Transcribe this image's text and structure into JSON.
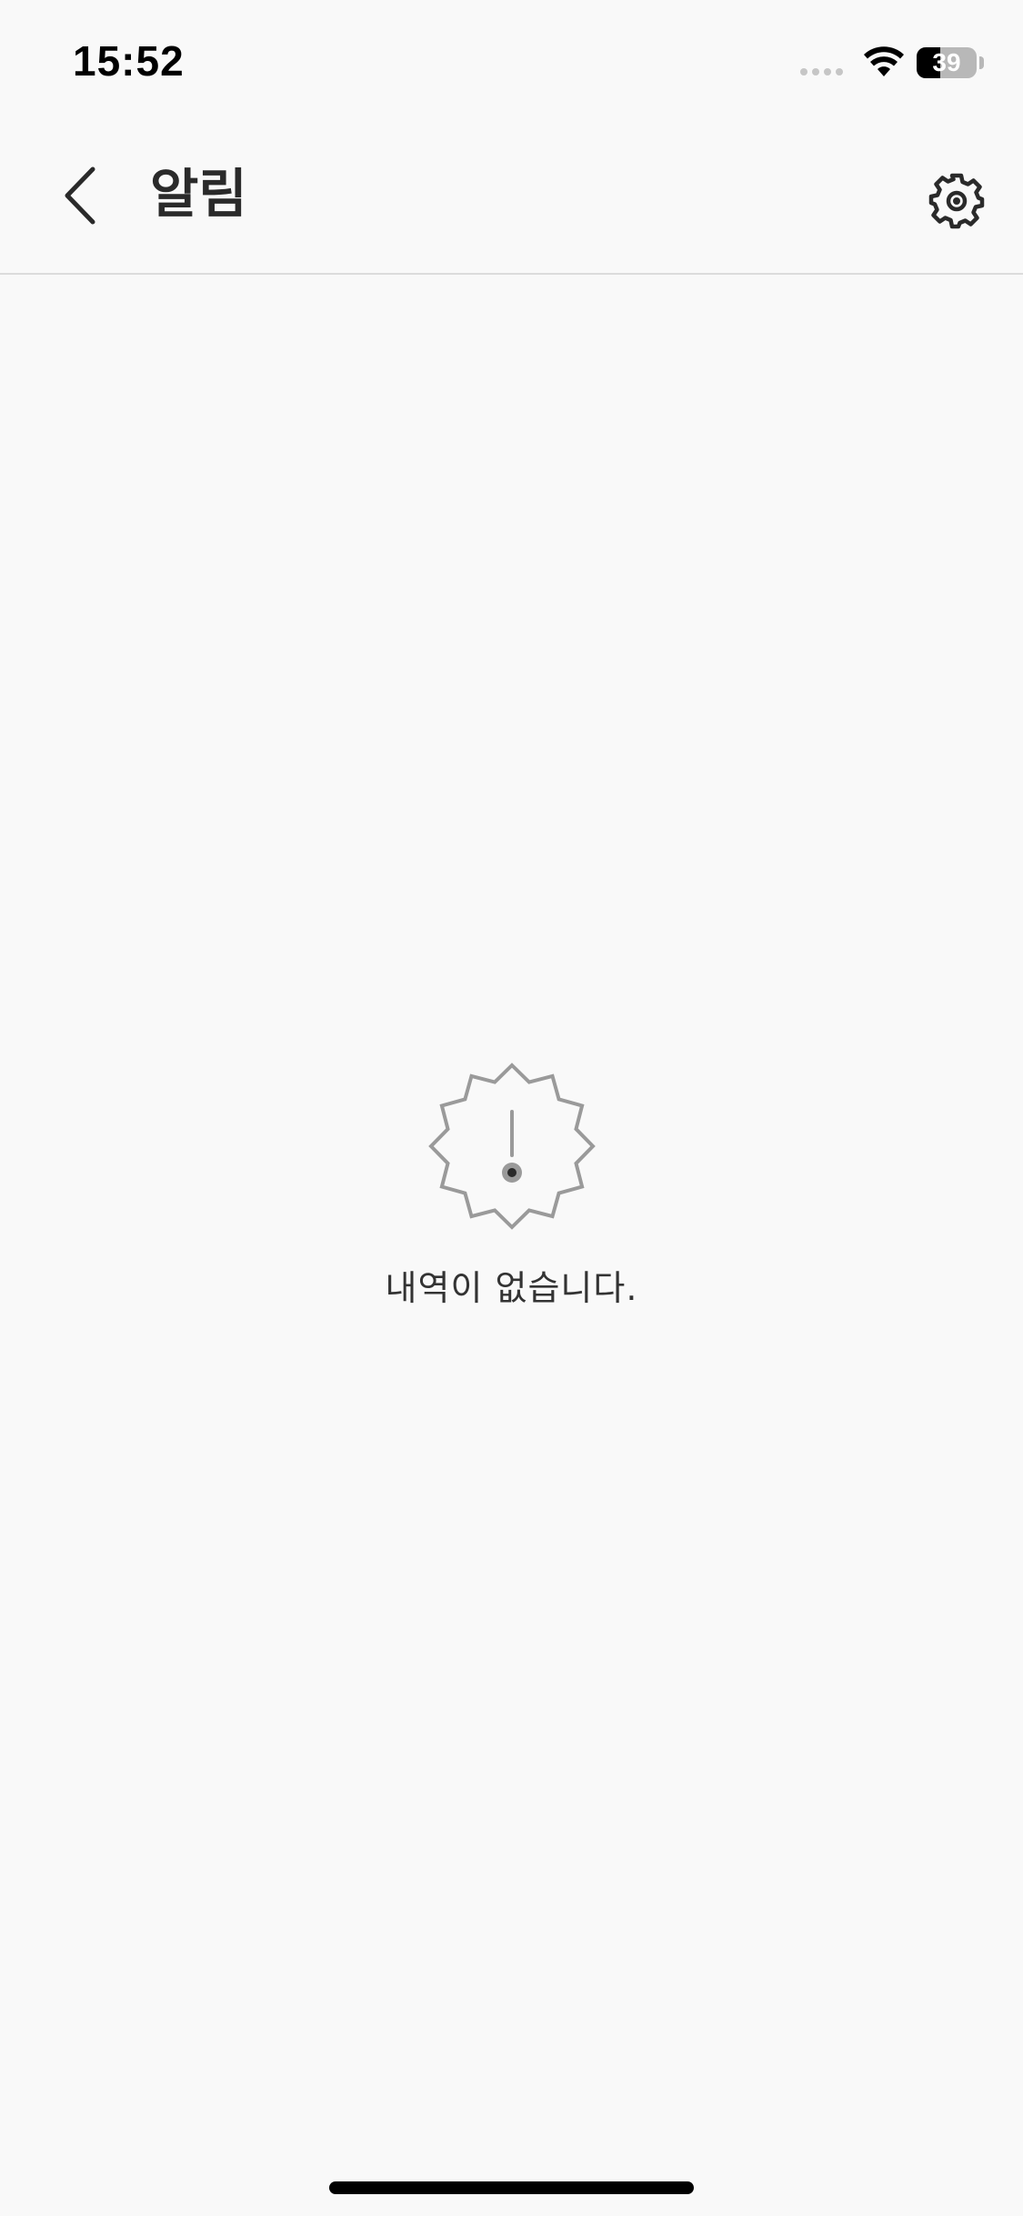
{
  "status_bar": {
    "time": "15:52",
    "battery_level": "39",
    "battery_fraction": 0.39
  },
  "header": {
    "title": "알림",
    "back_icon": "chevron-left-icon",
    "settings_icon": "gear-icon"
  },
  "empty_state": {
    "icon": "alert-badge-icon",
    "message": "내역이 없습니다."
  },
  "colors": {
    "background": "#f9f9f9",
    "title": "#2a2a2a",
    "icon_gray": "#9a9a9a",
    "divider": "#dcdcdc"
  }
}
